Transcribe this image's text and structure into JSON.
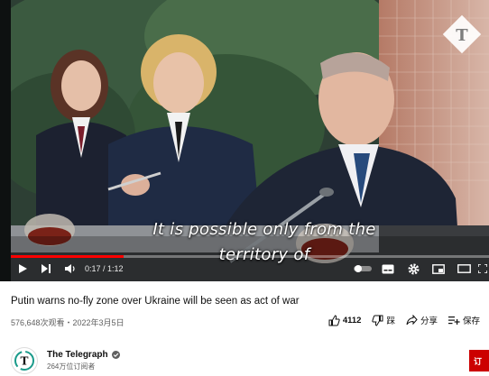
{
  "player": {
    "subtitle_line1": "It is possible only from the",
    "subtitle_line2": "territory of",
    "time_display": "0:17 / 1:12",
    "progress_fraction": 0.236,
    "accent_color": "#ff0000"
  },
  "video": {
    "title": "Putin warns no-fly zone over Ukraine will be seen as act of war",
    "meta": "576,648次观看・2022年3月5日",
    "likes": "4112",
    "dislike_label": "踩",
    "share_label": "分享",
    "save_label": "保存"
  },
  "channel": {
    "name": "The Telegraph",
    "subscribers": "264万位订阅者",
    "subscribe_label": "订"
  },
  "icons": {
    "play": "play-icon",
    "next": "next-icon",
    "volume": "volume-icon",
    "watermark": "telegraph-logo-icon",
    "like": "thumbs-up-icon",
    "dislike": "thumbs-down-icon",
    "share": "share-icon",
    "save": "playlist-add-icon",
    "verified": "verified-check-icon"
  }
}
